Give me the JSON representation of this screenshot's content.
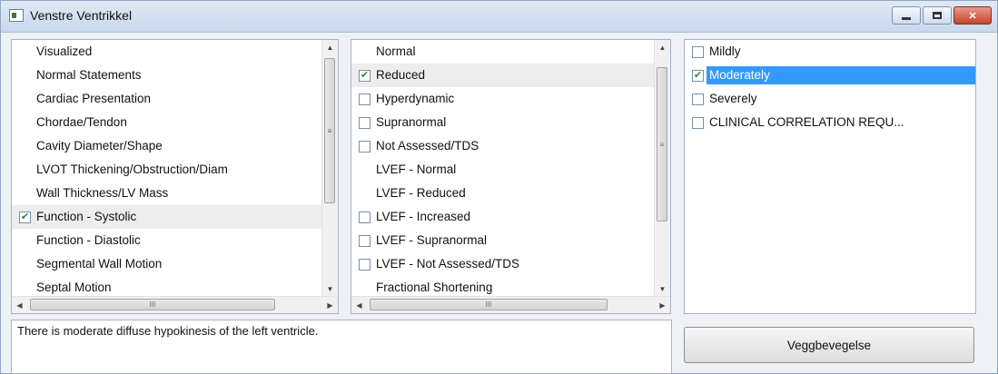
{
  "window": {
    "title": "Venstre Ventrikkel",
    "min_glyph": "",
    "max_glyph": "",
    "close_glyph": "✕"
  },
  "category_list": {
    "items": [
      {
        "label": "Visualized",
        "checkbox": false,
        "checked": false
      },
      {
        "label": "Normal Statements",
        "checkbox": false,
        "checked": false
      },
      {
        "label": "Cardiac Presentation",
        "checkbox": false,
        "checked": false
      },
      {
        "label": "Chordae/Tendon",
        "checkbox": false,
        "checked": false
      },
      {
        "label": "Cavity Diameter/Shape",
        "checkbox": false,
        "checked": false
      },
      {
        "label": "LVOT Thickening/Obstruction/Diam",
        "checkbox": false,
        "checked": false
      },
      {
        "label": "Wall Thickness/LV Mass",
        "checkbox": false,
        "checked": false
      },
      {
        "label": "Function - Systolic",
        "checkbox": true,
        "checked": true,
        "highlighted": true
      },
      {
        "label": "Function - Diastolic",
        "checkbox": false,
        "checked": false
      },
      {
        "label": "Segmental Wall Motion",
        "checkbox": false,
        "checked": false
      },
      {
        "label": "Septal Motion",
        "checkbox": false,
        "checked": false
      }
    ],
    "scroll_grip": "≡",
    "hscroll_grip": "III"
  },
  "finding_list": {
    "items": [
      {
        "label": "Normal",
        "checkbox": false,
        "checked": false
      },
      {
        "label": "Reduced",
        "checkbox": true,
        "checked": true,
        "highlighted": true
      },
      {
        "label": "Hyperdynamic",
        "checkbox": true,
        "checked": false
      },
      {
        "label": "Supranormal",
        "checkbox": true,
        "checked": false
      },
      {
        "label": "Not Assessed/TDS",
        "checkbox": true,
        "checked": false
      },
      {
        "label": "LVEF - Normal",
        "checkbox": false,
        "checked": false
      },
      {
        "label": "LVEF - Reduced",
        "checkbox": false,
        "checked": false
      },
      {
        "label": "LVEF - Increased",
        "checkbox": true,
        "checked": false
      },
      {
        "label": "LVEF - Supranormal",
        "checkbox": true,
        "checked": false
      },
      {
        "label": "LVEF - Not Assessed/TDS",
        "checkbox": true,
        "checked": false
      },
      {
        "label": "Fractional Shortening",
        "checkbox": false,
        "checked": false
      }
    ],
    "scroll_grip": "≡",
    "hscroll_grip": "III"
  },
  "severity_list": {
    "items": [
      {
        "label": "Mildly",
        "checkbox": true,
        "checked": false
      },
      {
        "label": "Moderately",
        "checkbox": true,
        "checked": true,
        "selected": true
      },
      {
        "label": "Severely",
        "checkbox": true,
        "checked": false
      },
      {
        "label": "CLINICAL CORRELATION REQU...",
        "checkbox": true,
        "checked": false
      }
    ]
  },
  "report_text": "There is moderate diffuse hypokinesis of the left ventricle.",
  "action_button": "Veggbevegelse",
  "glyphs": {
    "check": "✔",
    "up": "▲",
    "down": "▼",
    "left": "◀",
    "right": "▶"
  }
}
